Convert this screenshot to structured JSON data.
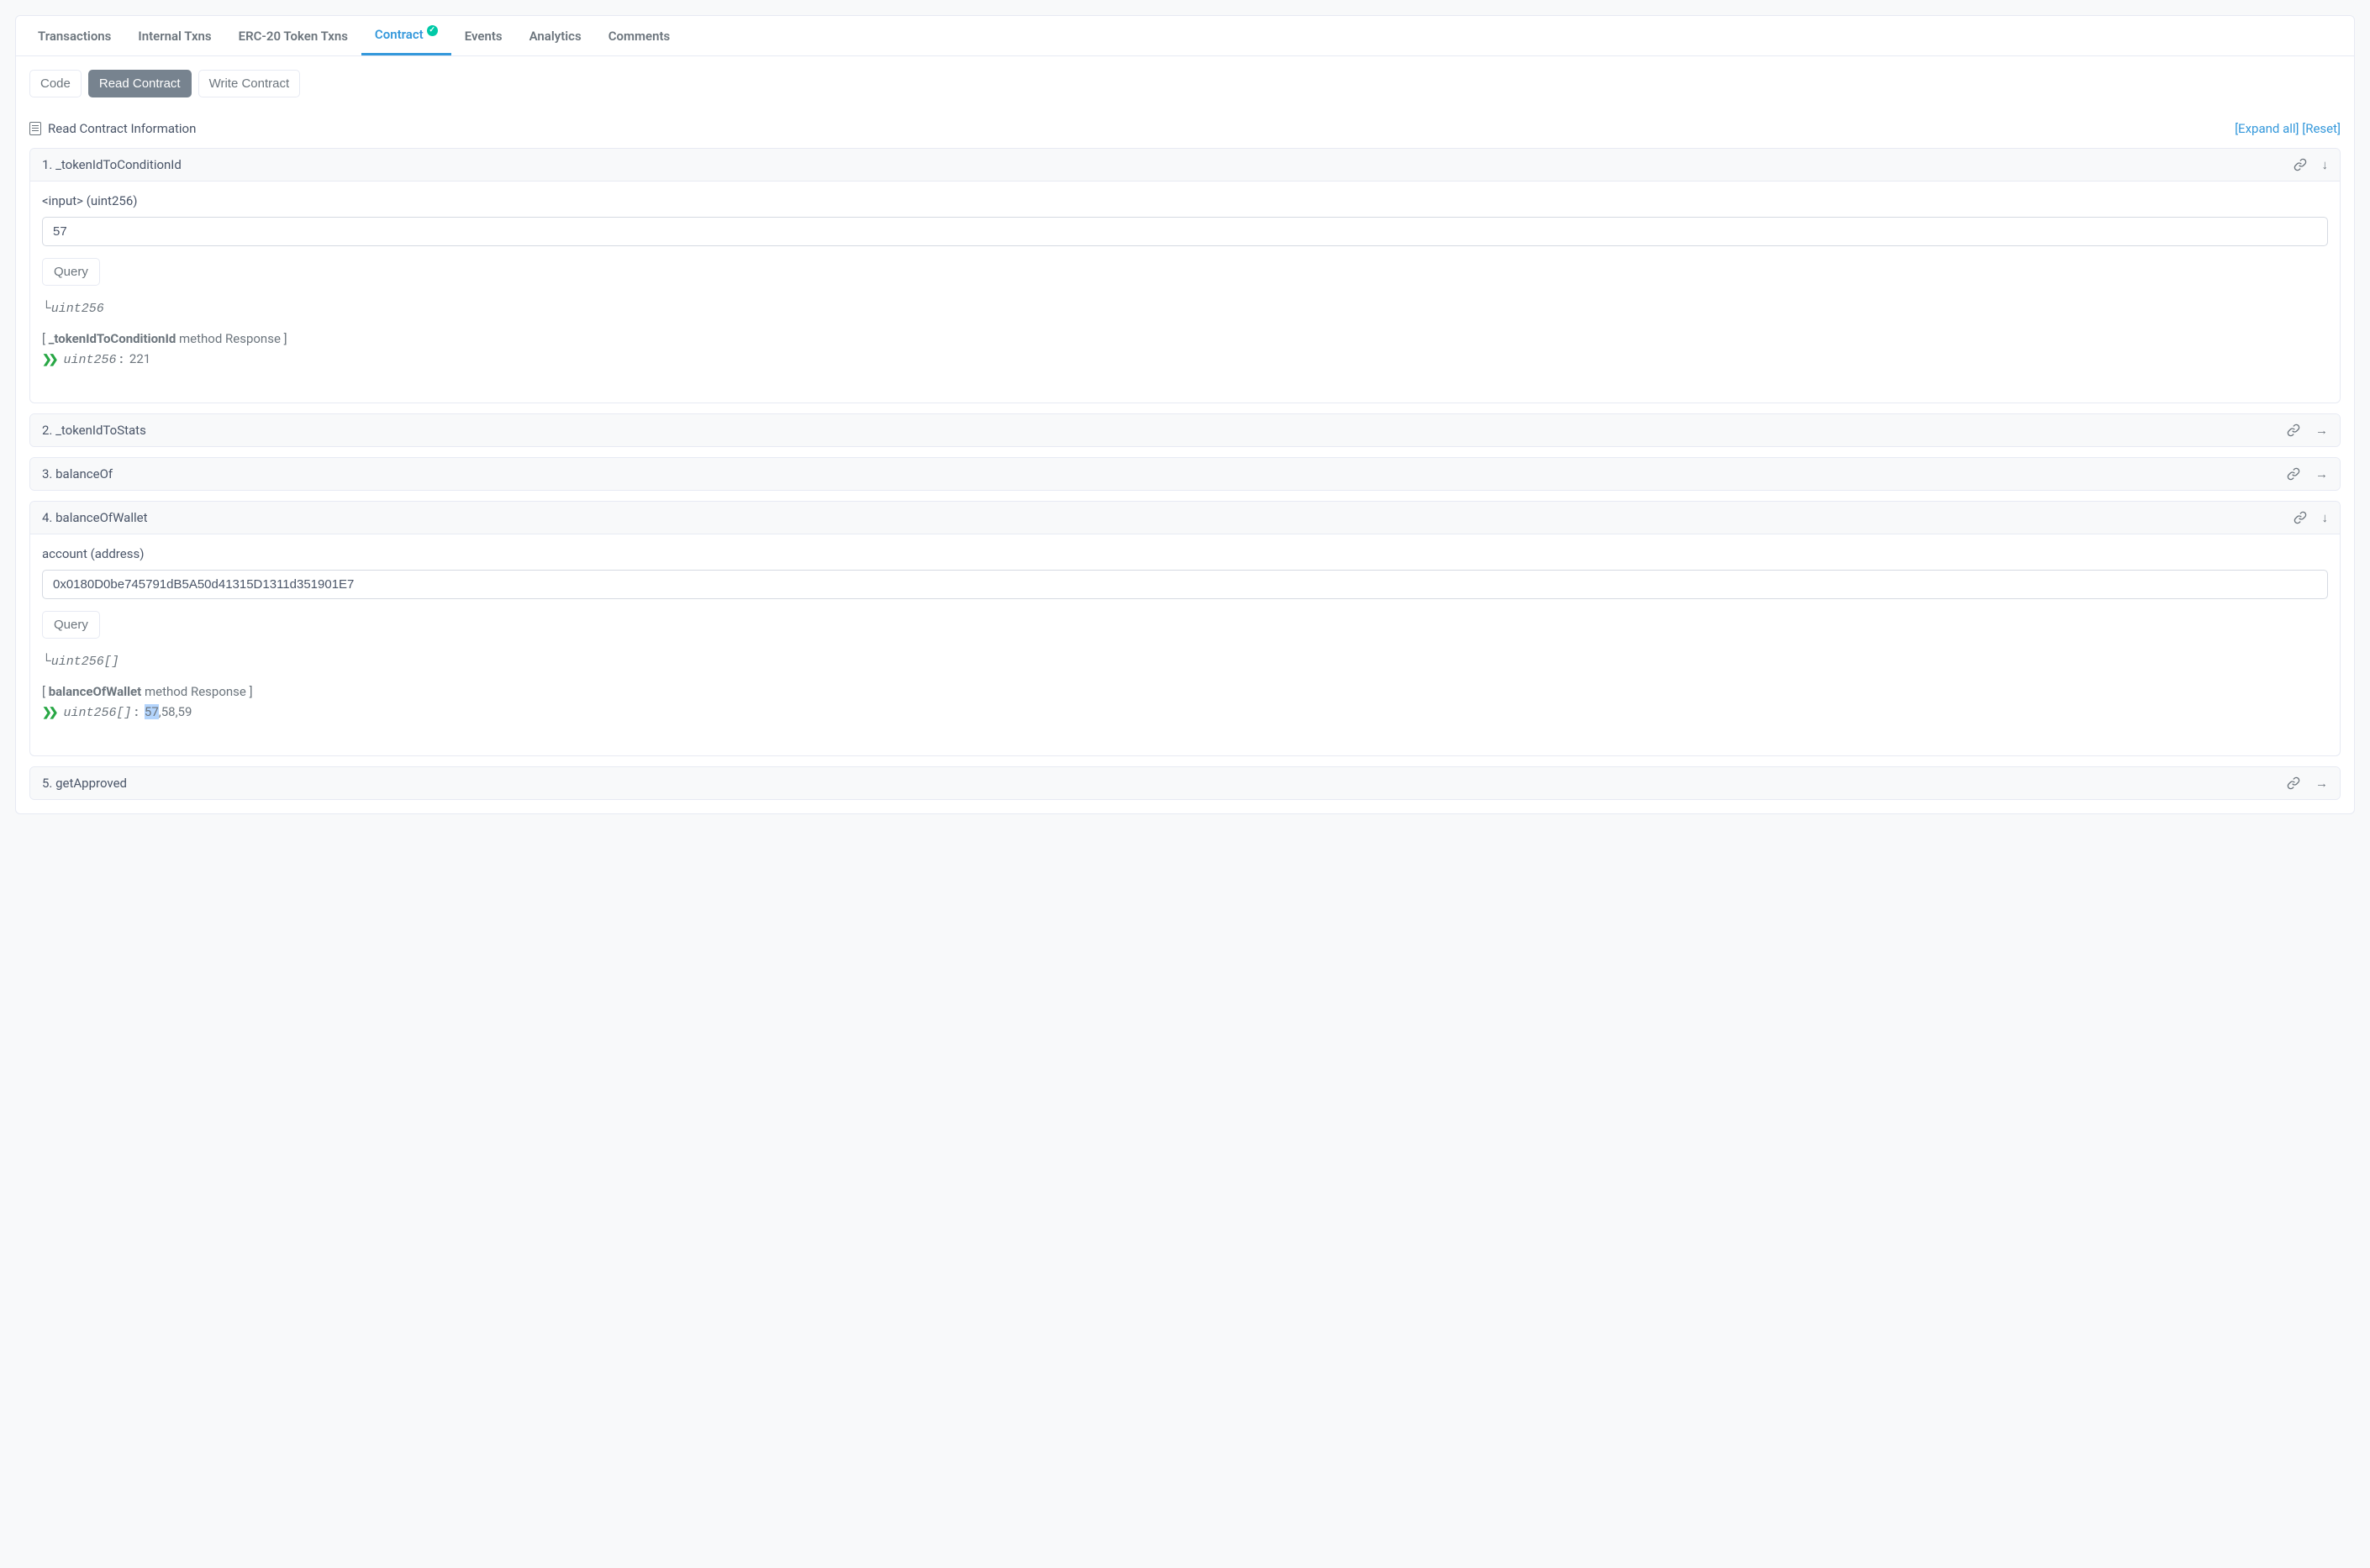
{
  "tabs": {
    "transactions": "Transactions",
    "internal": "Internal Txns",
    "erc20": "ERC-20 Token Txns",
    "contract": "Contract",
    "events": "Events",
    "analytics": "Analytics",
    "comments": "Comments"
  },
  "sub_tabs": {
    "code": "Code",
    "read": "Read Contract",
    "write": "Write Contract"
  },
  "section": {
    "title": "Read Contract Information",
    "expand": "[Expand all]",
    "reset": "[Reset]"
  },
  "methods": {
    "m1": {
      "title": "1. _tokenIdToConditionId",
      "input_label": "<input> (uint256)",
      "input_value": "57",
      "query": "Query",
      "return_type": "uint256",
      "response_label_pre": "[ ",
      "response_label_name": "_tokenIdToConditionId",
      "response_label_post": " method Response ]",
      "response_type": "uint256",
      "response_value": "221"
    },
    "m2": {
      "title": "2. _tokenIdToStats"
    },
    "m3": {
      "title": "3. balanceOf"
    },
    "m4": {
      "title": "4. balanceOfWallet",
      "input_label": "account (address)",
      "input_value": "0x0180D0be745791dB5A50d41315D1311d351901E7",
      "query": "Query",
      "return_type": "uint256[]",
      "response_label_pre": "[ ",
      "response_label_name": "balanceOfWallet",
      "response_label_post": " method Response ]",
      "response_type": "uint256[]",
      "response_value_highlight": "57",
      "response_value_rest": ",58,59"
    },
    "m5": {
      "title": "5. getApproved"
    }
  }
}
